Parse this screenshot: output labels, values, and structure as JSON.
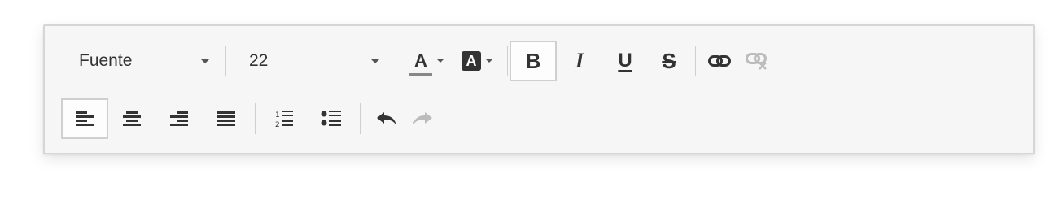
{
  "toolbar": {
    "font_select": {
      "label": "Fuente"
    },
    "size_select": {
      "label": "22"
    },
    "text_color": {
      "glyph": "A",
      "icon": "text-color-icon"
    },
    "background_color": {
      "glyph": "A",
      "icon": "background-color-icon"
    },
    "bold": {
      "label": "B",
      "active": true
    },
    "italic": {
      "label": "I"
    },
    "underline": {
      "label": "U"
    },
    "strikethrough": {
      "label": "S"
    },
    "link": {
      "icon": "link-icon"
    },
    "unlink": {
      "icon": "unlink-icon",
      "disabled": true
    },
    "align_left": {
      "icon": "align-left-icon",
      "active": true
    },
    "align_center": {
      "icon": "align-center-icon"
    },
    "align_right": {
      "icon": "align-right-icon"
    },
    "align_justify": {
      "icon": "align-justify-icon"
    },
    "ordered_list": {
      "icon": "ordered-list-icon"
    },
    "bullet_list": {
      "icon": "bullet-list-icon"
    },
    "undo": {
      "icon": "undo-icon"
    },
    "redo": {
      "icon": "redo-icon",
      "disabled": true
    }
  },
  "colors": {
    "toolbar_bg": "#f6f6f6",
    "icon": "#333333",
    "disabled_icon": "#bcbcbc",
    "separator": "#cfcfcf"
  }
}
